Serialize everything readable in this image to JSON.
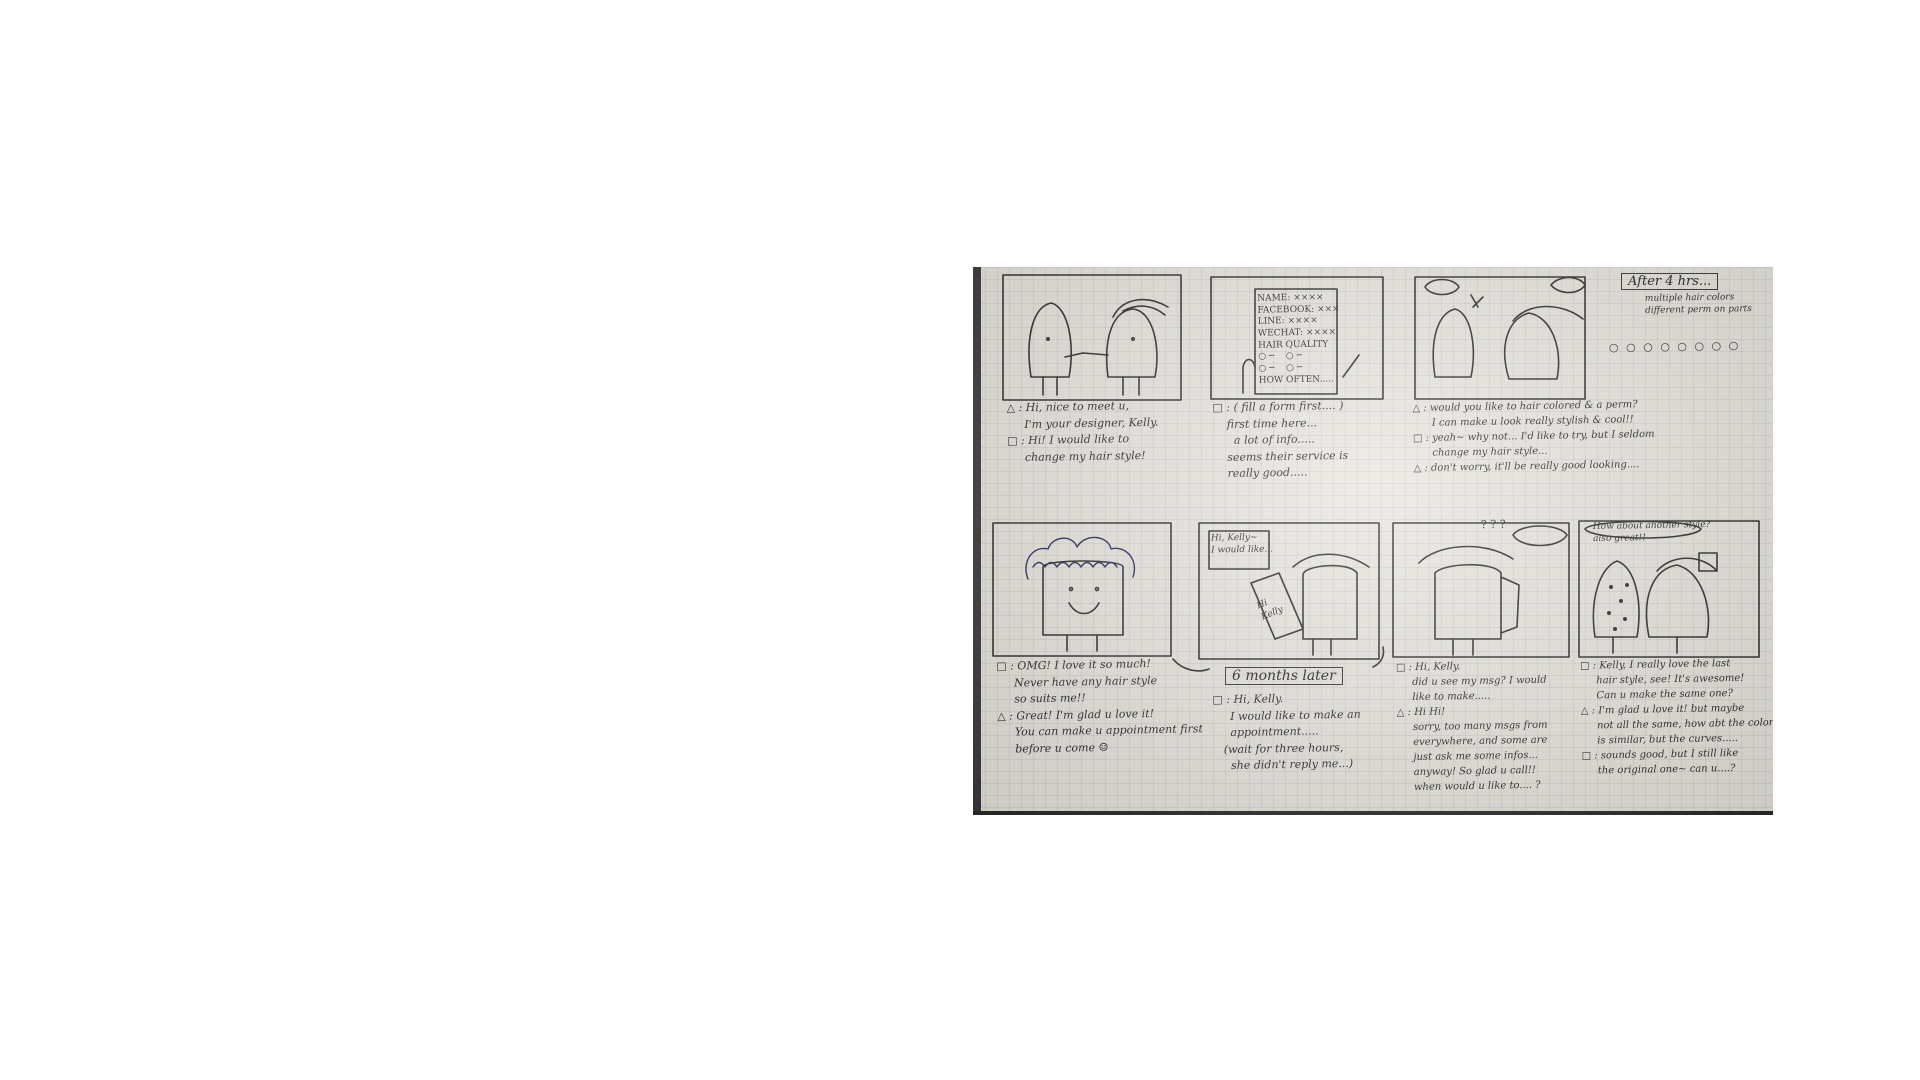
{
  "storyboard": {
    "panel1_caption": "△ : Hi, nice to meet u,\n     I'm your designer, Kelly.\n□ : Hi! I would like to\n     change my hair style!",
    "panel2_form": "NAME: ××××\nFACEBOOK: ×××\nLINE: ××××\nWECHAT: ××××\nHAIR QUALITY\n○ ─    ○ ─\n○ ─    ○ ─\nHOW OFTEN.....",
    "panel2_caption": "□ : ( fill a form first.... )\n    first time here...\n      a lot of info.....\n    seems their service is\n    really good.....",
    "panel3_caption": "△ : would you like to hair colored & a perm?\n      I can make u look really stylish & cool!!\n□ : yeah~ why not... I'd like to try, but I seldom\n      change my hair style...\n△ : don't worry, it'll be really good looking....",
    "after_label": "After 4 hrs...",
    "after_note": "multiple hair colors\ndifferent perm on parts",
    "after_dots": "○ ○ ○ ○ ○ ○ ○ ○",
    "panel5_caption": "□ : OMG! I love it so much!\n     Never have any hair style\n     so suits me!!\n△ : Great! I'm glad u love it!\n     You can make u appointment first\n     before u come ☺",
    "panel6_bubble": "Hi, Kelly~\nI would like...",
    "panel6_phone": "Hi\nKelly",
    "months_label": "6 months later",
    "panel6_caption": "□ : Hi, Kelly.\n     I would like to make an\n     appointment.....\n   (wait for three hours,\n     she didn't reply me...)",
    "panel7_bubble": "? ? ?",
    "panel7_caption": "□ : Hi, Kelly.\n     did u see my msg? I would\n     like to make.....\n△ : Hi Hi!\n     sorry, too many msgs from\n     everywhere, and some are\n     just ask me some infos...\n     anyway! So glad u call!!\n     when would u like to.... ?",
    "panel8_bubble": "How about another style?\nalso great!!",
    "panel8_caption": "□ : Kelly, I really love the last\n     hair style, see! It's awesome!\n     Can u make the same one?\n△ : I'm glad u love it! but maybe\n     not all the same, how abt the color\n     is similar, but the curves.....\n□ : sounds good, but I still like\n     the original one~ can u....?"
  }
}
